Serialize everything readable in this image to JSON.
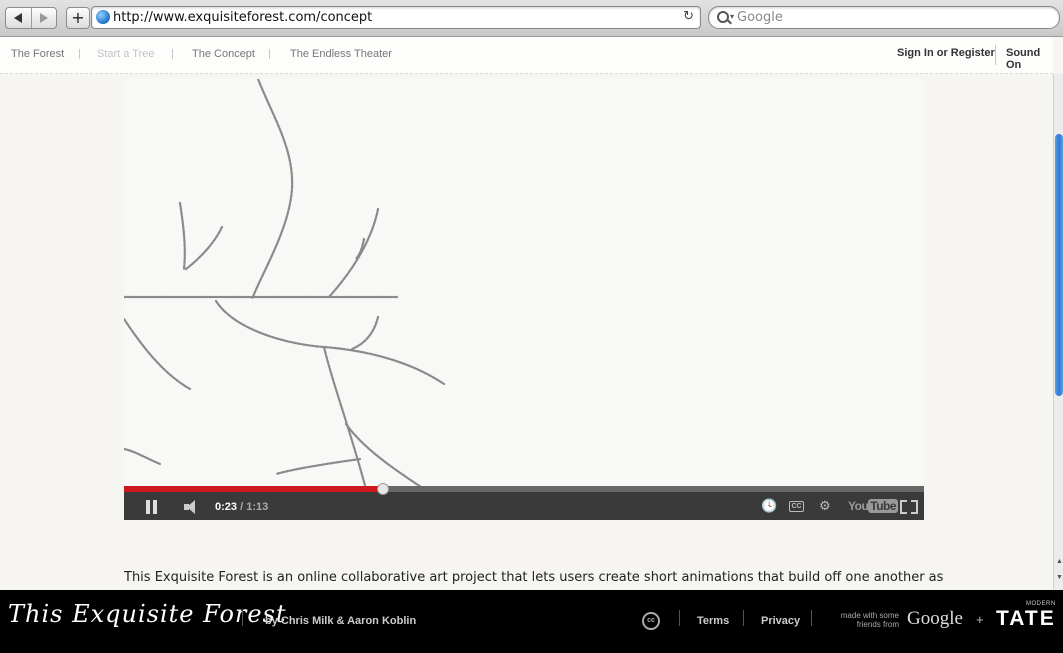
{
  "browser": {
    "url": "http://www.exquisiteforest.com/concept",
    "search_placeholder": "Google"
  },
  "site_nav": {
    "items": [
      {
        "label": "The Forest",
        "state": "normal"
      },
      {
        "label": "Start a Tree",
        "state": "dimmed"
      },
      {
        "label": "The Concept",
        "state": "normal"
      },
      {
        "label": "The Endless Theater",
        "state": "normal"
      }
    ],
    "sign_in": "Sign In or Register",
    "sound": "Sound On"
  },
  "video": {
    "current_time": "0:23",
    "duration": "/ 1:13",
    "progress_fraction": 0.3233,
    "youtube_logo": "You",
    "youtube_logo_tube": "Tube"
  },
  "description": "This Exquisite Forest is an online collaborative art project that lets users create short animations that build off one another as",
  "footer": {
    "logo": "This Exquisite Forest",
    "byline": "by Chris Milk & Aaron Koblin",
    "cc": "cc",
    "terms": "Terms",
    "privacy": "Privacy",
    "made_with_line1": "made with some",
    "made_with_line2": "friends from",
    "google": "Google",
    "plus": "+",
    "tate_top": "MODERN",
    "tate": "TATE"
  },
  "colors": {
    "progress_red": "#cc181e",
    "scroll_blue": "#2f78d2",
    "footer_bg": "#000000"
  }
}
